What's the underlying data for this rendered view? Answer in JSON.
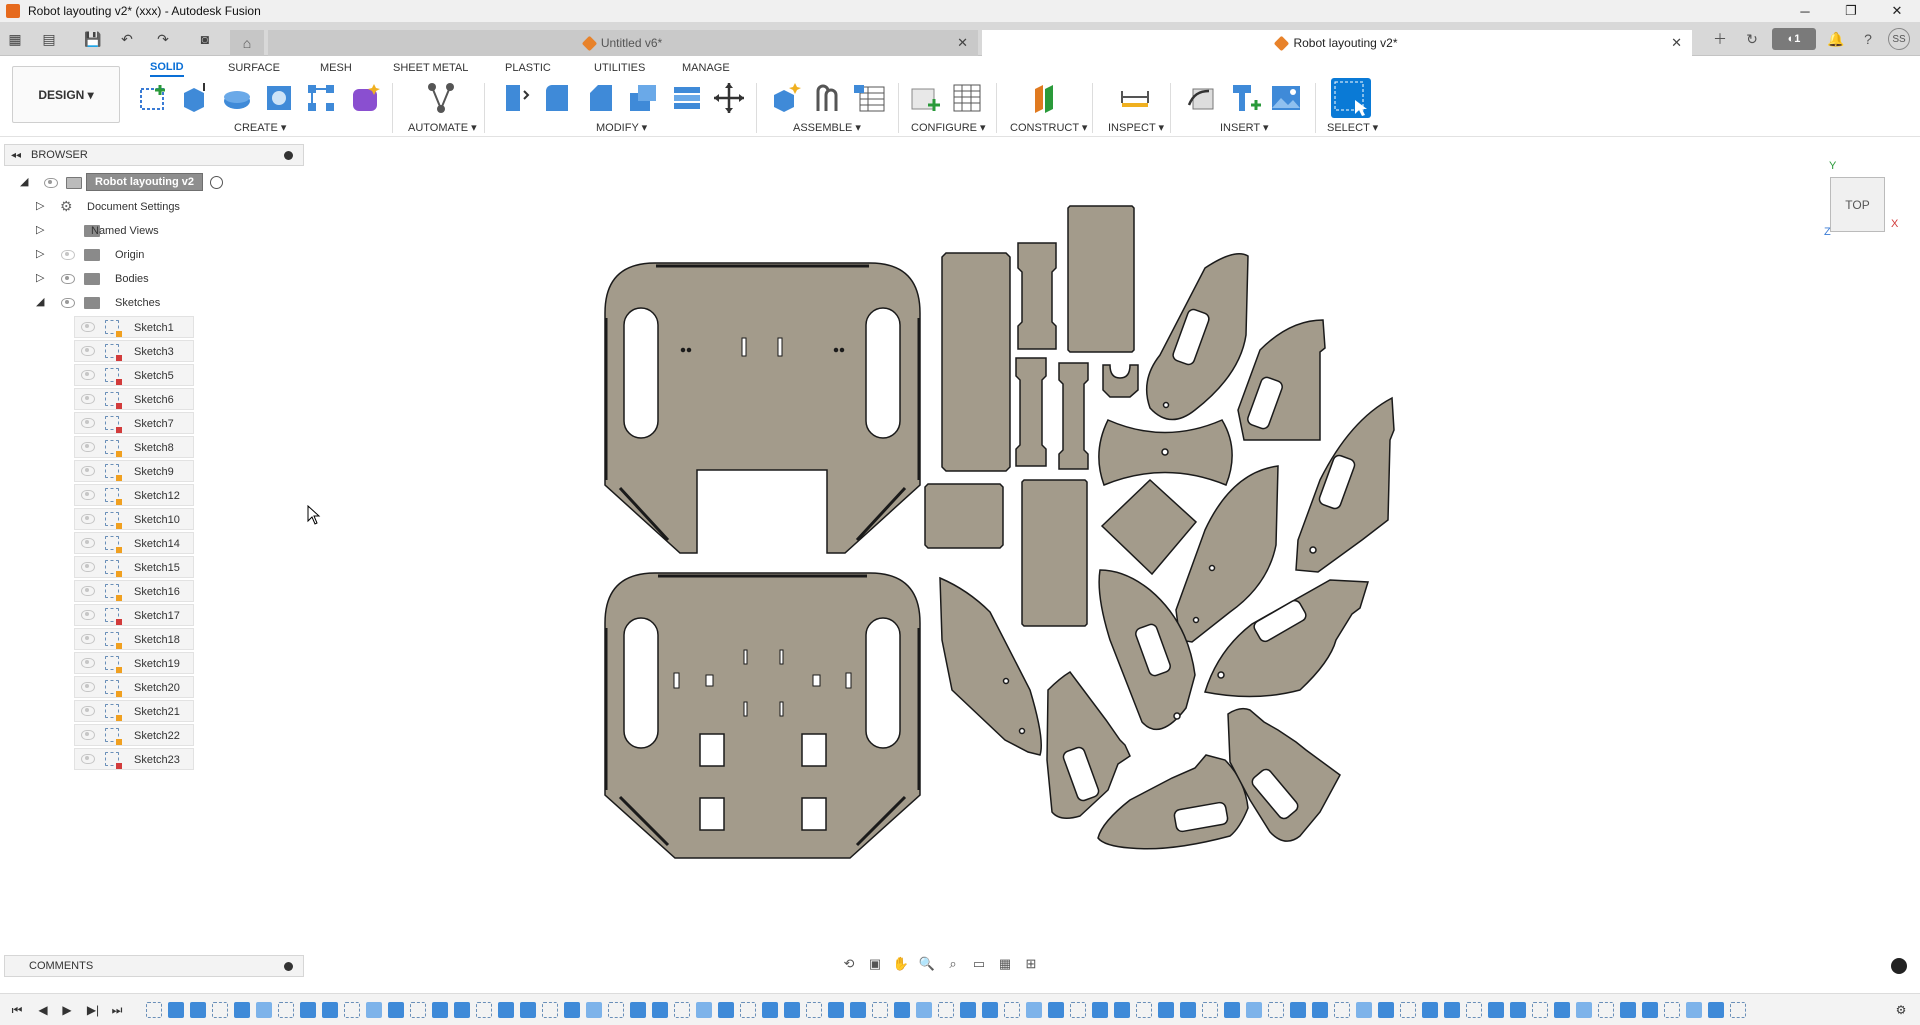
{
  "window": {
    "title": "Robot layouting v2* (xxx) - Autodesk Fusion",
    "controls": [
      "─",
      "❐",
      "✕"
    ]
  },
  "tabs": {
    "inactive": {
      "label": "Untitled v6*"
    },
    "active": {
      "label": "Robot layouting v2*"
    },
    "jobs_badge": "1",
    "user_initials": "SS"
  },
  "ribbon": {
    "workspace": "DESIGN",
    "tabs": [
      "SOLID",
      "SURFACE",
      "MESH",
      "SHEET METAL",
      "PLASTIC",
      "UTILITIES",
      "MANAGE"
    ],
    "selected_tab": "SOLID",
    "groups": [
      "CREATE",
      "AUTOMATE",
      "MODIFY",
      "ASSEMBLE",
      "CONFIGURE",
      "CONSTRUCT",
      "INSPECT",
      "INSERT",
      "SELECT"
    ]
  },
  "browser": {
    "title": "BROWSER",
    "root": "Robot layouting v2",
    "nodes": [
      "Document Settings",
      "Named Views",
      "Origin",
      "Bodies",
      "Sketches"
    ],
    "sketches": [
      {
        "name": "Sketch1",
        "warn": false
      },
      {
        "name": "Sketch3",
        "warn": true
      },
      {
        "name": "Sketch5",
        "warn": true
      },
      {
        "name": "Sketch6",
        "warn": true
      },
      {
        "name": "Sketch7",
        "warn": true
      },
      {
        "name": "Sketch8",
        "warn": false
      },
      {
        "name": "Sketch9",
        "warn": false
      },
      {
        "name": "Sketch12",
        "warn": false
      },
      {
        "name": "Sketch10",
        "warn": false
      },
      {
        "name": "Sketch14",
        "warn": false
      },
      {
        "name": "Sketch15",
        "warn": false
      },
      {
        "name": "Sketch16",
        "warn": false
      },
      {
        "name": "Sketch17",
        "warn": true
      },
      {
        "name": "Sketch18",
        "warn": false
      },
      {
        "name": "Sketch19",
        "warn": false
      },
      {
        "name": "Sketch20",
        "warn": false
      },
      {
        "name": "Sketch21",
        "warn": false
      },
      {
        "name": "Sketch22",
        "warn": false
      },
      {
        "name": "Sketch23",
        "warn": true
      }
    ]
  },
  "viewcube": {
    "face": "TOP",
    "x": "X",
    "y": "Y",
    "z": "Z"
  },
  "comments": {
    "title": "COMMENTS"
  },
  "colors": {
    "part_fill": "#a39b8b",
    "part_stroke": "#1a1a1a",
    "accent": "#0a6fd6",
    "sketch_warn": "#d23b3b",
    "sketch_ok": "#f0a020"
  }
}
